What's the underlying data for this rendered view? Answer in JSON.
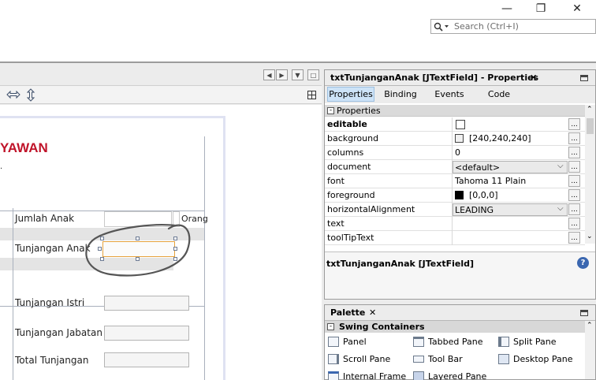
{
  "window": {
    "minimize": "—",
    "maximize": "❐",
    "close": "✕"
  },
  "search": {
    "placeholder": "Search (Ctrl+I)"
  },
  "editor": {
    "heading": "YAWAN",
    "labels": {
      "jumlah_anak": "Jumlah Anak",
      "orang": "Orang",
      "tunjangan_anak": "Tunjangan Anak",
      "tunjangan_istri": "Tunjangan Istri",
      "tunjangan_jabatan": "Tunjangan Jabatan",
      "total_tunjangan": "Total Tunjangan"
    },
    "nav": {
      "prev": "◀",
      "next": "▶",
      "menu": "▼",
      "restore": "□"
    }
  },
  "properties": {
    "title": "txtTunjanganAnak [JTextField] - Properties",
    "tabs": [
      "Properties",
      "Binding",
      "Events",
      "Code"
    ],
    "section": "Properties",
    "rows": [
      {
        "name": "editable",
        "value": ""
      },
      {
        "name": "background",
        "value": "[240,240,240]"
      },
      {
        "name": "columns",
        "value": "0"
      },
      {
        "name": "document",
        "value": "<default>"
      },
      {
        "name": "font",
        "value": "Tahoma 11 Plain"
      },
      {
        "name": "foreground",
        "value": "[0,0,0]"
      },
      {
        "name": "horizontalAlignment",
        "value": "LEADING"
      },
      {
        "name": "text",
        "value": ""
      },
      {
        "name": "toolTipText",
        "value": ""
      }
    ],
    "ellipsis": "...",
    "description": "txtTunjanganAnak [JTextField]",
    "help": "?"
  },
  "palette": {
    "title": "Palette",
    "category": "Swing Containers",
    "items": [
      "Panel",
      "Tabbed Pane",
      "Split Pane",
      "Scroll Pane",
      "Tool Bar",
      "Desktop Pane",
      "Internal Frame",
      "Layered Pane"
    ]
  },
  "colors": {
    "heading": "#c0142a",
    "annotation": "#555555",
    "selection": "#e6a23c"
  }
}
